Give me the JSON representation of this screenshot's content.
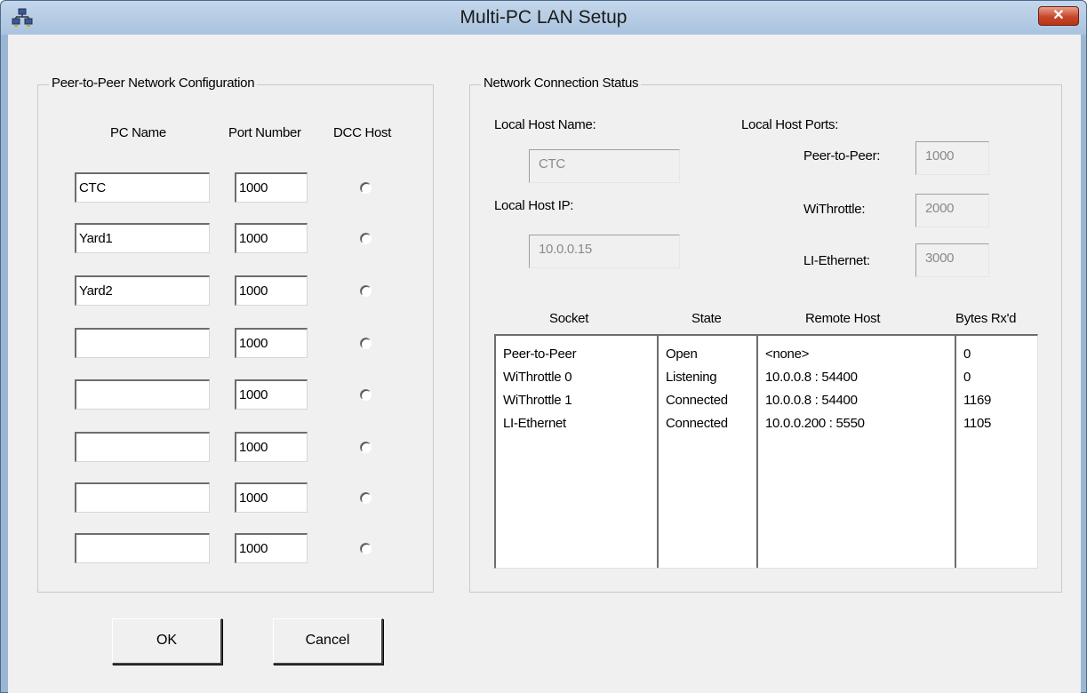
{
  "window": {
    "title": "Multi-PC LAN Setup",
    "close_label": "✕",
    "icon": "network-pcs-icon"
  },
  "peer_config": {
    "group_title": "Peer-to-Peer Network Configuration",
    "col_pc_name": "PC Name",
    "col_port": "Port Number",
    "col_dcc": "DCC Host",
    "rows": [
      {
        "name": "CTC",
        "port": "1000"
      },
      {
        "name": "Yard1",
        "port": "1000"
      },
      {
        "name": "Yard2",
        "port": "1000"
      },
      {
        "name": "",
        "port": "1000"
      },
      {
        "name": "",
        "port": "1000"
      },
      {
        "name": "",
        "port": "1000"
      },
      {
        "name": "",
        "port": "1000"
      },
      {
        "name": "",
        "port": "1000"
      }
    ]
  },
  "status": {
    "group_title": "Network Connection Status",
    "local_host_name_label": "Local Host Name:",
    "local_host_name": "CTC",
    "local_host_ip_label": "Local Host IP:",
    "local_host_ip": "10.0.0.15",
    "local_host_ports_label": "Local Host Ports:",
    "peer_label": "Peer-to-Peer:",
    "peer_port": "1000",
    "withrottle_label": "WiThrottle:",
    "withrottle_port": "2000",
    "li_label": "LI-Ethernet:",
    "li_port": "3000",
    "table_headers": {
      "socket": "Socket",
      "state": "State",
      "remote": "Remote Host",
      "bytes": "Bytes Rx'd"
    },
    "sockets": [
      "Peer-to-Peer",
      "WiThrottle 0",
      "WiThrottle 1",
      "LI-Ethernet"
    ],
    "states": [
      "Open",
      "Listening",
      "Connected",
      "Connected"
    ],
    "remotes": [
      "<none>",
      "10.0.0.8 : 54400",
      "10.0.0.8 : 54400",
      "10.0.0.200 : 5550"
    ],
    "bytes": [
      "0",
      "0",
      "1169",
      "1105"
    ]
  },
  "buttons": {
    "ok": "OK",
    "cancel": "Cancel"
  }
}
